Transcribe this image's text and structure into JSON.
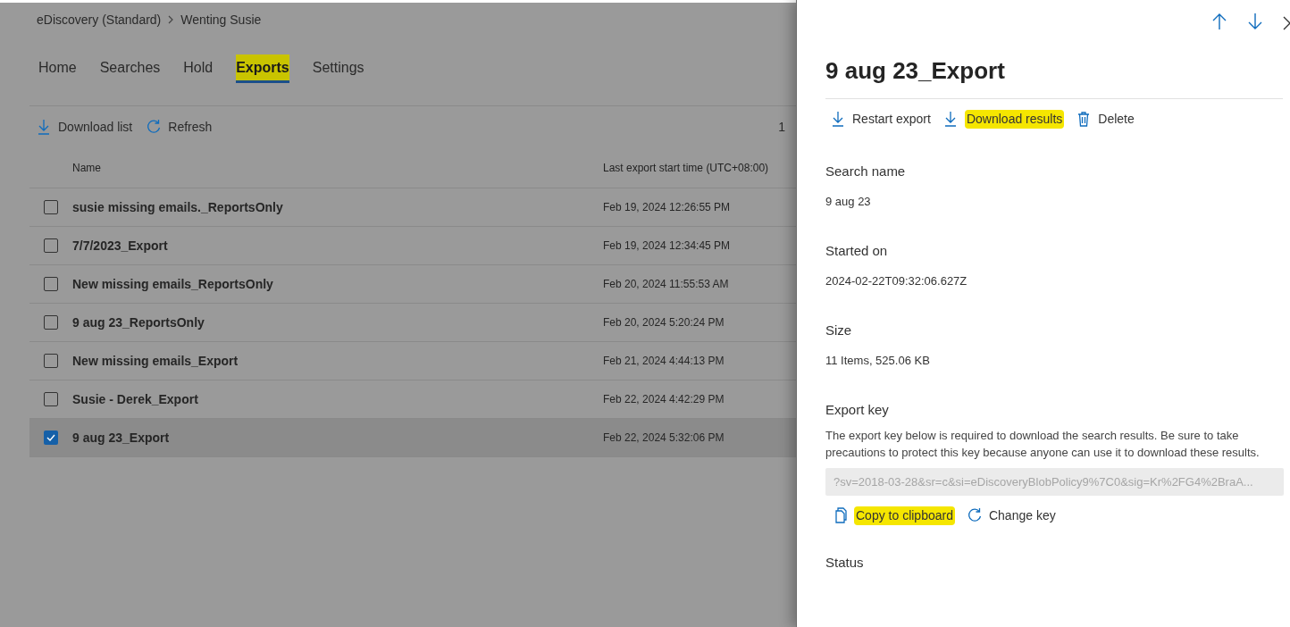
{
  "breadcrumb": [
    "eDiscovery (Standard)",
    "Wenting Susie"
  ],
  "tabs": [
    {
      "label": "Home",
      "selected": false
    },
    {
      "label": "Searches",
      "selected": false
    },
    {
      "label": "Hold",
      "selected": false
    },
    {
      "label": "Exports",
      "selected": true,
      "highlighted": true
    },
    {
      "label": "Settings",
      "selected": false
    }
  ],
  "toolbar": [
    {
      "label": "Download list",
      "kind": "download"
    },
    {
      "label": "Refresh",
      "kind": "refresh"
    }
  ],
  "item_count": "1",
  "table": {
    "columns": [
      "Name",
      "Last export start time (UTC+08:00)"
    ],
    "rows": [
      {
        "name": "susie missing emails._ReportsOnly",
        "time": "Feb 19, 2024 12:26:55 PM",
        "selected": false
      },
      {
        "name": "7/7/2023_Export",
        "time": "Feb 19, 2024 12:34:45 PM",
        "selected": false
      },
      {
        "name": "New missing emails_ReportsOnly",
        "time": "Feb 20, 2024 11:55:53 AM",
        "selected": false
      },
      {
        "name": "9 aug 23_ReportsOnly",
        "time": "Feb 20, 2024 5:20:24 PM",
        "selected": false
      },
      {
        "name": "New missing emails_Export",
        "time": "Feb 21, 2024 4:44:13 PM",
        "selected": false
      },
      {
        "name": "Susie - Derek_Export",
        "time": "Feb 22, 2024 4:42:29 PM",
        "selected": false
      },
      {
        "name": "9 aug 23_Export",
        "time": "Feb 22, 2024 5:32:06 PM",
        "selected": true
      }
    ]
  },
  "panel": {
    "title": "9 aug 23_Export",
    "actions": [
      {
        "label": "Restart export",
        "kind": "download",
        "highlighted": false
      },
      {
        "label": "Download results",
        "kind": "download",
        "highlighted": true
      },
      {
        "label": "Delete",
        "kind": "delete",
        "highlighted": false
      }
    ],
    "fields": [
      {
        "label": "Search name",
        "value": "9 aug 23"
      },
      {
        "label": "Started on",
        "value": "2024-02-22T09:32:06.627Z"
      },
      {
        "label": "Size",
        "value": "11 Items, 525.06 KB"
      }
    ],
    "export_key": {
      "label": "Export key",
      "description": "The export key below is required to download the search results. Be sure to take precautions to protect this key because anyone can use it to download these results.",
      "value": "?sv=2018-03-28&sr=c&si=eDiscoveryBlobPolicy9%7C0&sig=Kr%2FG4%2BraA...",
      "actions": [
        {
          "label": "Copy to clipboard",
          "kind": "copy",
          "highlighted": true
        },
        {
          "label": "Change key",
          "kind": "refresh",
          "highlighted": false
        }
      ]
    },
    "status_label": "Status"
  }
}
